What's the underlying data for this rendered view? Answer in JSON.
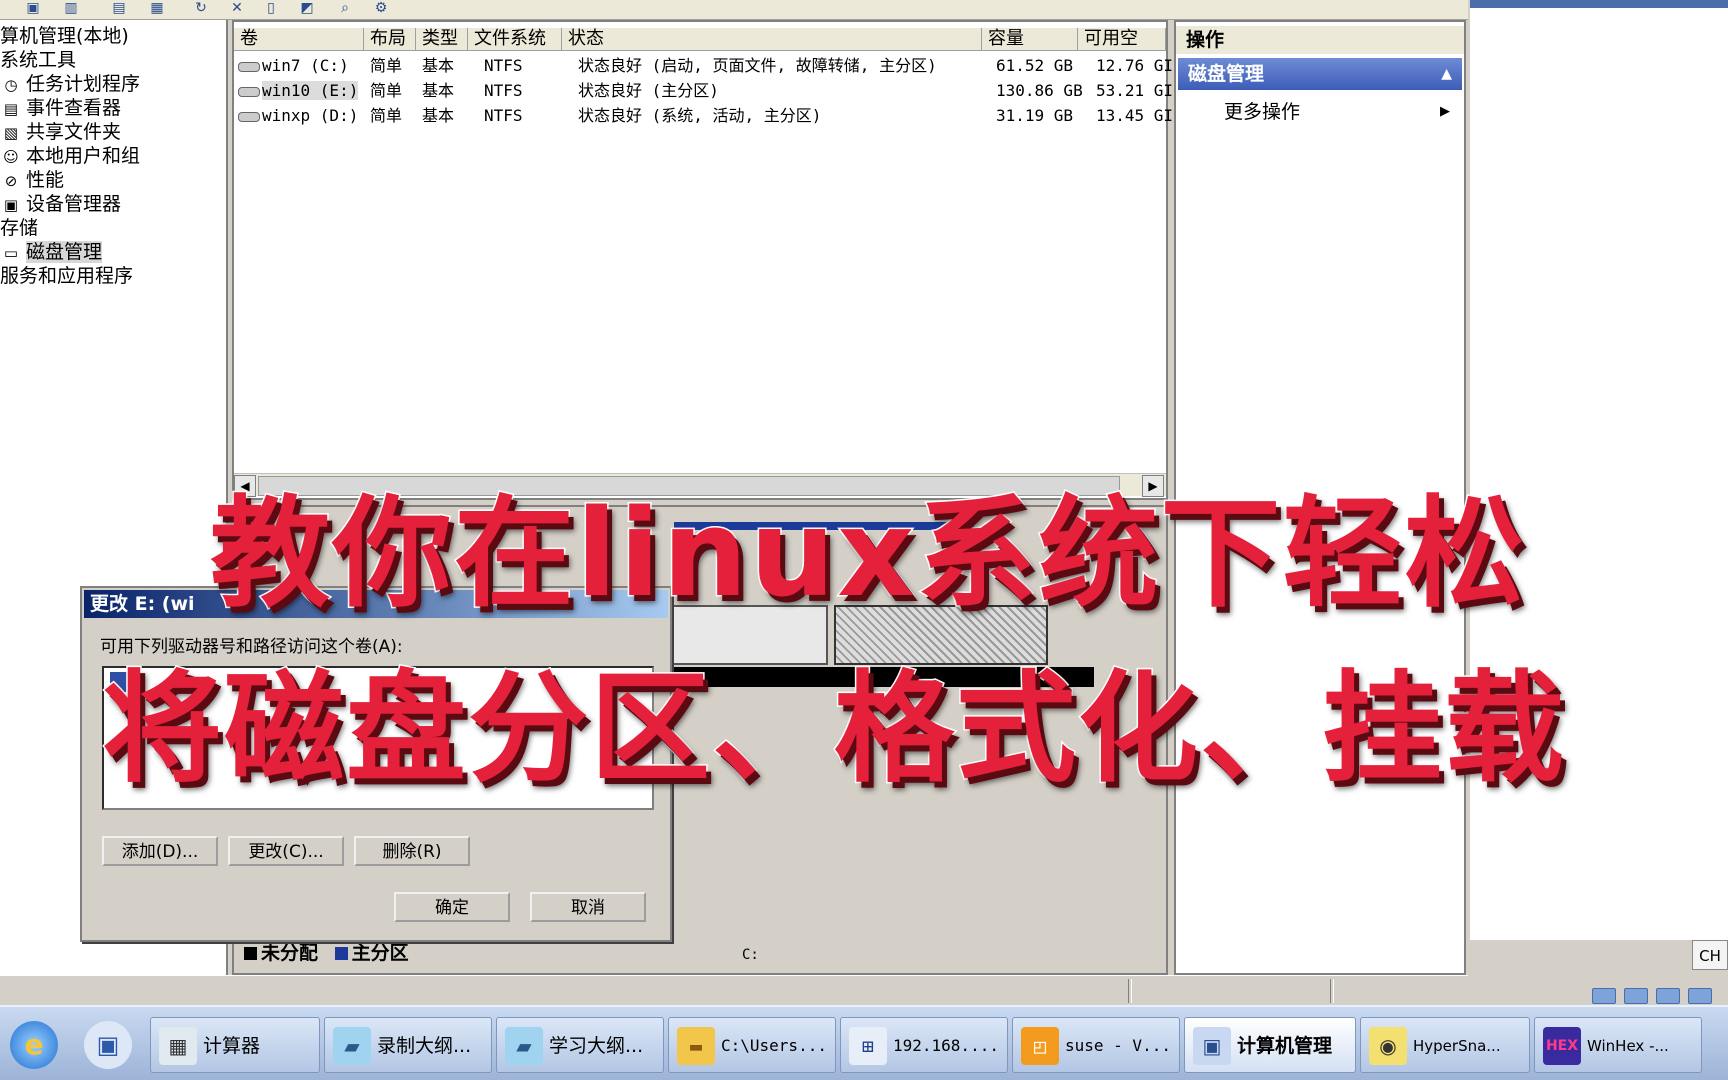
{
  "tree": {
    "items": [
      {
        "label": "算机管理(本地)",
        "icon": ""
      },
      {
        "label": "系统工具",
        "icon": ""
      },
      {
        "label": "任务计划程序",
        "icon": "clock-icon"
      },
      {
        "label": "事件查看器",
        "icon": "event-viewer-icon"
      },
      {
        "label": "共享文件夹",
        "icon": "shared-folder-icon"
      },
      {
        "label": "本地用户和组",
        "icon": "users-icon"
      },
      {
        "label": "性能",
        "icon": "performance-icon"
      },
      {
        "label": "设备管理器",
        "icon": "device-manager-icon"
      },
      {
        "label": "存储",
        "icon": ""
      },
      {
        "label": "磁盘管理",
        "icon": "disk-icon"
      },
      {
        "label": "服务和应用程序",
        "icon": ""
      }
    ]
  },
  "volumes": {
    "columns": [
      "卷",
      "布局",
      "类型",
      "文件系统",
      "状态",
      "容量",
      "可用空"
    ],
    "rows": [
      {
        "volume": "win7 (C:)",
        "layout": "简单",
        "type": "基本",
        "fs": "NTFS",
        "status": "状态良好 (启动, 页面文件, 故障转储, 主分区)",
        "capacity": "61.52 GB",
        "free": "12.76 GI"
      },
      {
        "volume": "win10 (E:)",
        "layout": "简单",
        "type": "基本",
        "fs": "NTFS",
        "status": "状态良好 (主分区)",
        "capacity": "130.86 GB",
        "free": "53.21 GI"
      },
      {
        "volume": "winxp (D:)",
        "layout": "简单",
        "type": "基本",
        "fs": "NTFS",
        "status": "状态良好 (系统, 活动, 主分区)",
        "capacity": "31.19 GB",
        "free": "13.45 GI"
      }
    ]
  },
  "legend": {
    "unallocated": "未分配",
    "primary": "主分区",
    "unallocated_color": "#000000",
    "primary_color": "#1c3a9a"
  },
  "graph": {
    "drive_label": "C:"
  },
  "actions": {
    "title": "操作",
    "section": "磁盘管理",
    "more": "更多操作"
  },
  "dialog": {
    "title": "更改 E: (wi",
    "label": "可用下列驱动器号和路径访问这个卷(A):",
    "add": "添加(D)...",
    "change": "更改(C)...",
    "remove": "删除(R)",
    "ok": "确定",
    "cancel": "取消"
  },
  "overlay": {
    "line1": "教你在linux系统下轻松",
    "line2": "将磁盘分区、格式化、挂载"
  },
  "right_window": {
    "ch": "CH"
  },
  "taskbar": {
    "items": [
      {
        "label": "计算器",
        "icon": "calculator-icon"
      },
      {
        "label": "录制大纲...",
        "icon": "notepad-icon"
      },
      {
        "label": "学习大纲...",
        "icon": "notepad-icon"
      },
      {
        "label": "C:\\Users...",
        "icon": "folder-icon"
      },
      {
        "label": "192.168....",
        "icon": "network-icon"
      },
      {
        "label": "suse - V...",
        "icon": "vmware-icon"
      },
      {
        "label": "计算机管理",
        "icon": "computer-management-icon"
      },
      {
        "label": "HyperSna...",
        "icon": "camera-icon"
      },
      {
        "label": "WinHex -...",
        "icon": "hex-icon"
      }
    ],
    "hex_logo": "HEX"
  }
}
